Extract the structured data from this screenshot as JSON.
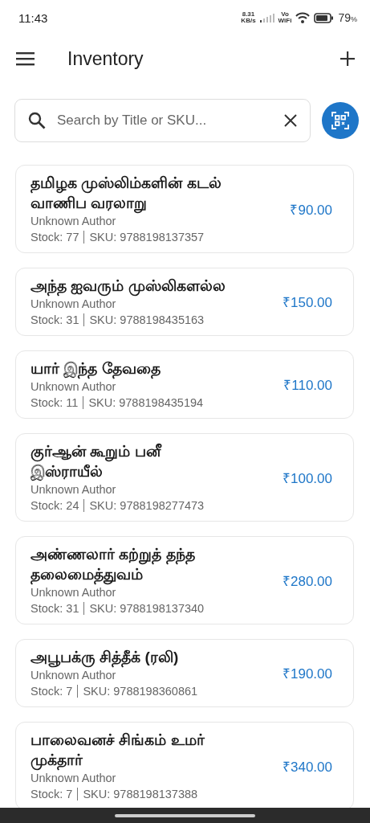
{
  "status_bar": {
    "time": "11:43",
    "net_speed": "8.31",
    "net_unit": "KB/s",
    "volte_top": "Vo",
    "volte_bottom": "WiFi",
    "battery": "79",
    "battery_unit": "%"
  },
  "app_bar": {
    "title": "Inventory"
  },
  "search": {
    "placeholder": "Search by Title or SKU..."
  },
  "books": [
    {
      "title": "தமிழக முஸ்லிம்களின் கடல் வாணிப வரலாறு",
      "author": "Unknown Author",
      "stock": "Stock: 77",
      "sku": "SKU: 9788198137357",
      "price": "₹90.00"
    },
    {
      "title": "அந்த ஐவரும் முஸ்லிகளல்ல",
      "author": "Unknown Author",
      "stock": "Stock: 31",
      "sku": "SKU: 9788198435163",
      "price": "₹150.00"
    },
    {
      "title": "யார் இந்த தேவதை",
      "author": "Unknown Author",
      "stock": "Stock: 11",
      "sku": "SKU: 9788198435194",
      "price": "₹110.00"
    },
    {
      "title": "குர்ஆன் கூறும் பனீ இஸ்ராயீல்",
      "author": "Unknown Author",
      "stock": "Stock: 24",
      "sku": "SKU: 9788198277473",
      "price": "₹100.00"
    },
    {
      "title": "அண்ணலார் கற்றுத் தந்த தலைமைத்துவம்",
      "author": "Unknown Author",
      "stock": "Stock: 31",
      "sku": "SKU: 9788198137340",
      "price": "₹280.00"
    },
    {
      "title": "அபூபக்ரு சித்தீக் (ரலி)",
      "author": "Unknown Author",
      "stock": "Stock: 7",
      "sku": "SKU: 9788198360861",
      "price": "₹190.00"
    },
    {
      "title": "பாலைவனச் சிங்கம் உமர் முக்தார்",
      "author": "Unknown Author",
      "stock": "Stock: 7",
      "sku": "SKU: 9788198137388",
      "price": "₹340.00"
    }
  ]
}
